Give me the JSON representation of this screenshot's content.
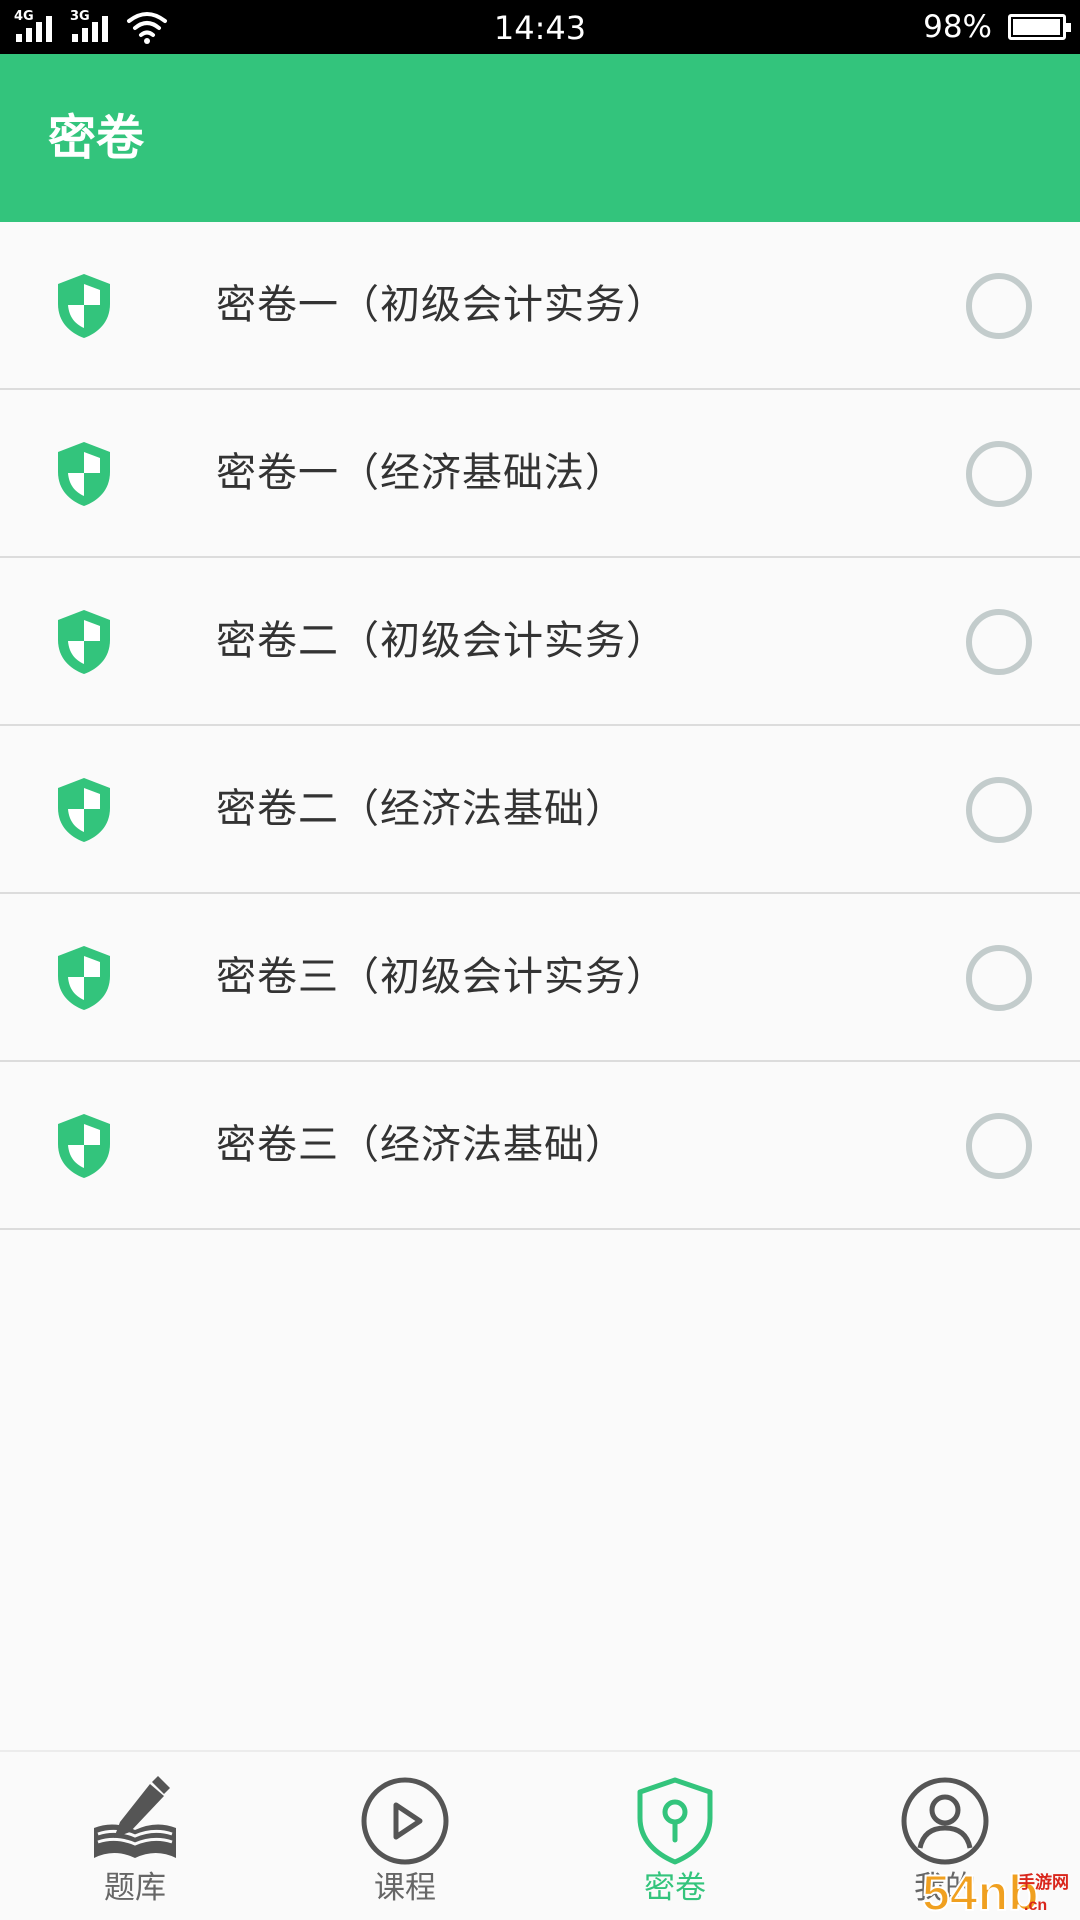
{
  "status_bar": {
    "network1": "4G",
    "network2": "3G",
    "time": "14:43",
    "battery_pct": "98%"
  },
  "header": {
    "title": "密卷"
  },
  "papers": [
    {
      "label": "密卷一（初级会计实务）",
      "selected": false
    },
    {
      "label": "密卷一（经济基础法）",
      "selected": false
    },
    {
      "label": "密卷二（初级会计实务）",
      "selected": false
    },
    {
      "label": "密卷二（经济法基础）",
      "selected": false
    },
    {
      "label": "密卷三（初级会计实务）",
      "selected": false
    },
    {
      "label": "密卷三（经济法基础）",
      "selected": false
    }
  ],
  "bottom_nav": {
    "tabs": [
      {
        "label": "题库",
        "icon": "book-pen-icon"
      },
      {
        "label": "课程",
        "icon": "play-circle-icon"
      },
      {
        "label": "密卷",
        "icon": "shield-key-icon",
        "active": true
      },
      {
        "label": "我的",
        "icon": "user-circle-icon"
      }
    ]
  },
  "watermark": {
    "text": "54nb手游网",
    "domain": "cn"
  },
  "colors": {
    "primary": "#33c47c",
    "radio_border": "#c3cccc",
    "text": "#333333",
    "tab_inactive": "#666666"
  }
}
